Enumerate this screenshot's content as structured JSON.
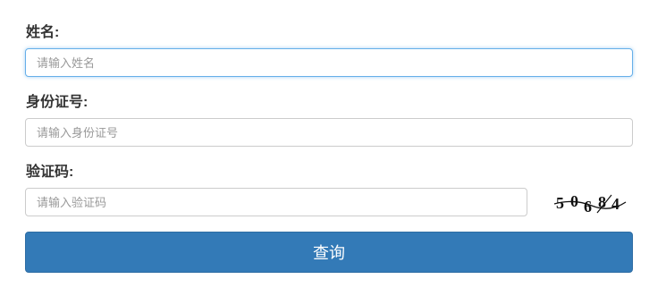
{
  "fields": {
    "name": {
      "label": "姓名:",
      "placeholder": "请输入姓名",
      "value": ""
    },
    "id_number": {
      "label": "身份证号:",
      "placeholder": "请输入身份证号",
      "value": ""
    },
    "captcha": {
      "label": "验证码:",
      "placeholder": "请输入验证码",
      "value": ""
    }
  },
  "captcha_image": {
    "text": "50684"
  },
  "submit": {
    "label": "查询",
    "color": "#337ab7"
  },
  "focus_color": "#66afe9"
}
